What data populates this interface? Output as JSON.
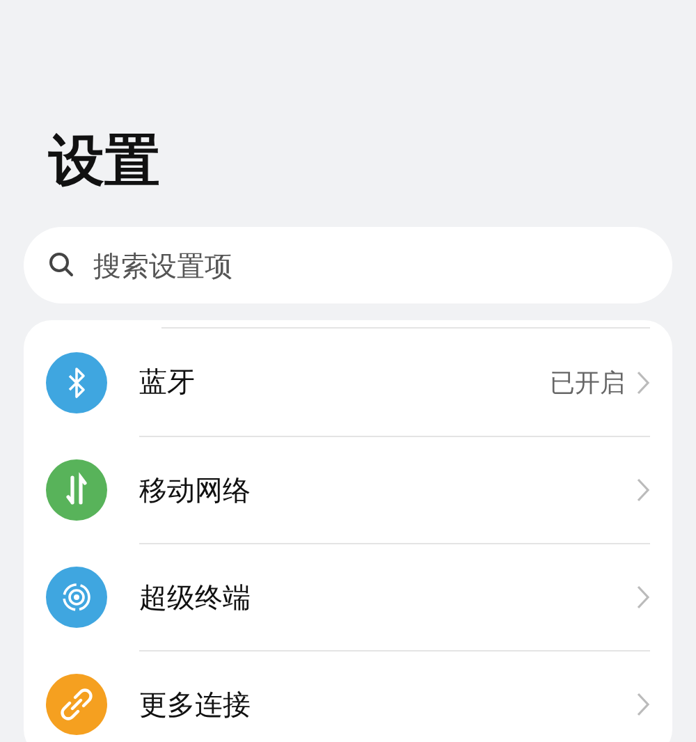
{
  "title": "设置",
  "search": {
    "placeholder": "搜索设置项"
  },
  "items": [
    {
      "label": "蓝牙",
      "value": "已开启",
      "color": "#3fa6e0"
    },
    {
      "label": "移动网络",
      "color": "#58b35a"
    },
    {
      "label": "超级终端",
      "color": "#3fa6e0"
    },
    {
      "label": "更多连接",
      "color": "#f5a020"
    }
  ]
}
